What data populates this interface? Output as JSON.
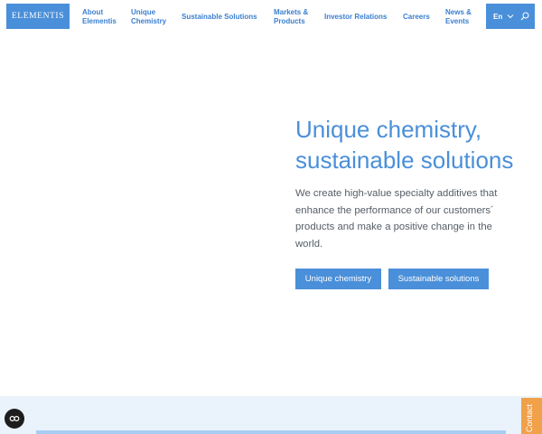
{
  "header": {
    "logo_text": "ELEMENTIS",
    "nav": [
      {
        "label": "About\nElementis"
      },
      {
        "label": "Unique\nChemistry"
      },
      {
        "label": "Sustainable Solutions"
      },
      {
        "label": "Markets &\nProducts"
      },
      {
        "label": "Investor Relations"
      },
      {
        "label": "Careers"
      },
      {
        "label": "News &\nEvents"
      }
    ],
    "language": "En",
    "icons": {
      "language_chevron": "chevron-down-icon",
      "search": "search-icon"
    }
  },
  "hero": {
    "title": "Unique chemistry, sustainable solutions",
    "description": "We create high-value specialty additives that enhance the performance of our customers´ products and make a positive change in the world.",
    "buttons": {
      "unique_chemistry": "Unique chemistry",
      "sustainable_solutions": "Sustainable solutions"
    }
  },
  "widgets": {
    "cookie_icon": "cookie-settings-icon",
    "contact_label": "Contact"
  },
  "colors": {
    "brand_blue": "#4a8fd9",
    "text_grey": "#555d66",
    "contact_orange": "#f0a14a",
    "band_light_blue": "#eaf3fc"
  }
}
